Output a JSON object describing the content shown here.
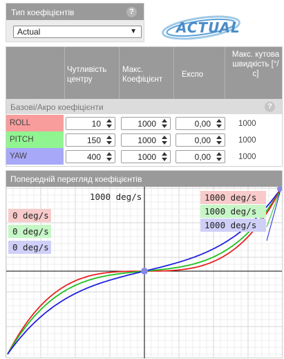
{
  "rates_type": {
    "title": "Тип коефіцієнтів",
    "help": "?",
    "selected": "Actual"
  },
  "logo_text": "ACTUAL",
  "table": {
    "headers": {
      "center": "Чутливість центру",
      "max": "Макс. Коефіцієнт",
      "expo": "Експо",
      "maxvel": "Макс. кутова швидкість [°/с]"
    },
    "section_label": "Базові/Акро коефіцієнти",
    "help": "?",
    "rows": [
      {
        "axis": "ROLL",
        "center": "10",
        "max": "1000",
        "expo": "0,00",
        "maxvel": "1000",
        "color": "#f89c9c"
      },
      {
        "axis": "PITCH",
        "center": "150",
        "max": "1000",
        "expo": "0,00",
        "maxvel": "1000",
        "color": "#90f590"
      },
      {
        "axis": "YAW",
        "center": "400",
        "max": "1000",
        "expo": "0,00",
        "maxvel": "1000",
        "color": "#a8a8f8"
      }
    ]
  },
  "preview": {
    "title": "Попередній перегляд коефіцієнтів",
    "max_label": "1000 deg/s",
    "curve_labels": [
      "1000 deg/s",
      "1000 deg/s",
      "1000 deg/s"
    ],
    "live_labels": [
      "0 deg/s",
      "0 deg/s",
      "0 deg/s"
    ],
    "colors": {
      "roll": "#e82020",
      "pitch": "#20c020",
      "yaw": "#2020e0"
    }
  }
}
